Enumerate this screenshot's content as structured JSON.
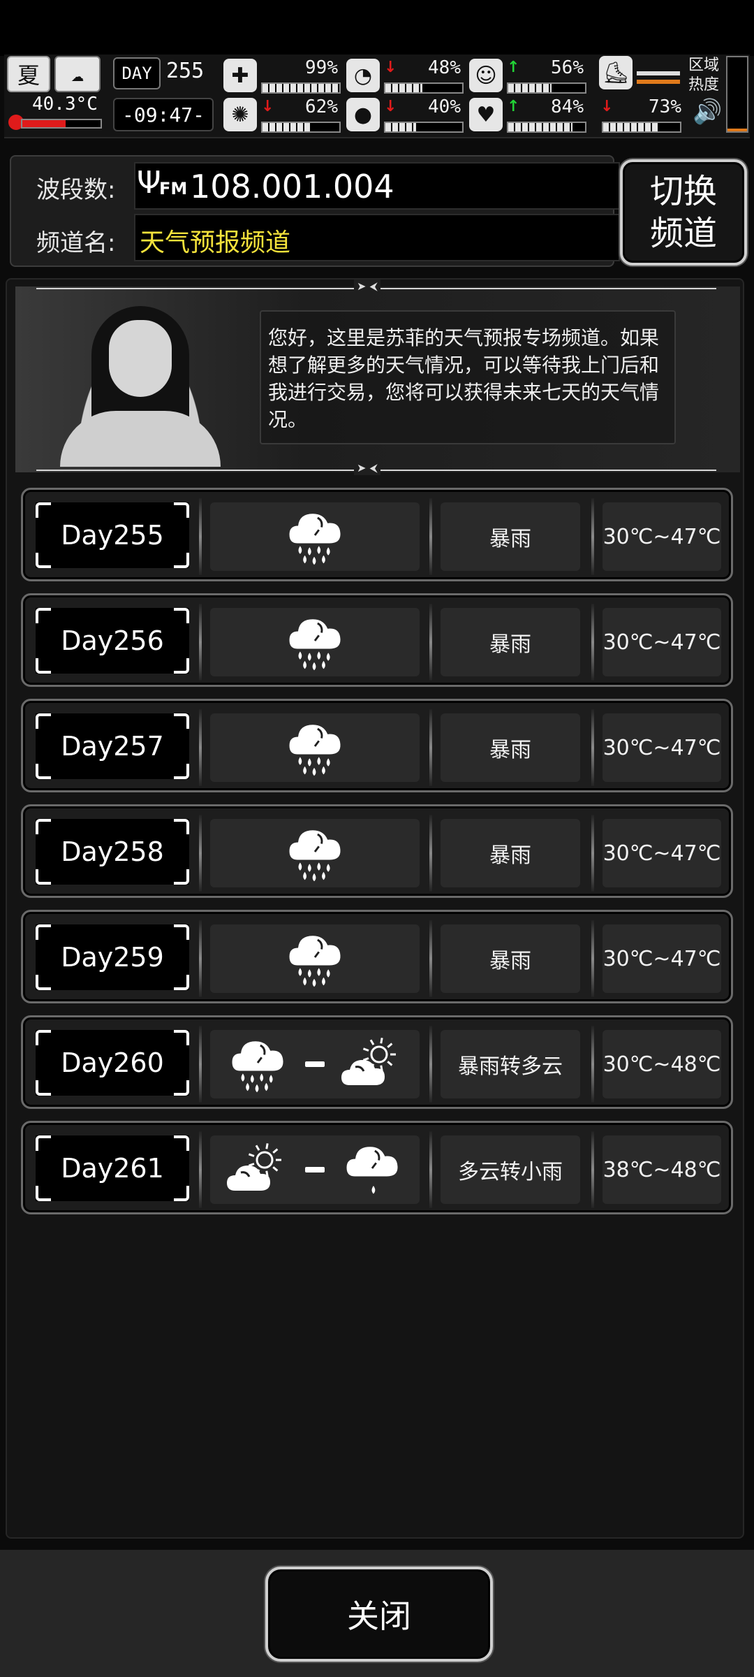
{
  "hud": {
    "season": "夏",
    "day_label": "DAY",
    "day_number": "255",
    "temperature": "40.3°C",
    "time": "-09:47-",
    "area_heat_label_1": "区域",
    "area_heat_label_2": "热度",
    "stats": [
      {
        "icon": "medkit-icon",
        "glyph": "✚",
        "value": "99%",
        "trend": "",
        "fill": 0.99
      },
      {
        "icon": "stomach-icon",
        "glyph": "◔",
        "value": "48%",
        "trend": "down",
        "fill": 0.48
      },
      {
        "icon": "mood-icon",
        "glyph": "☺",
        "value": "56%",
        "trend": "up",
        "fill": 0.56
      },
      {
        "icon": "brain-icon",
        "glyph": "✺",
        "value": "62%",
        "trend": "down",
        "fill": 0.62
      },
      {
        "icon": "water-drop-icon",
        "glyph": "💧",
        "value": "40%",
        "trend": "down",
        "fill": 0.4
      },
      {
        "icon": "heart-icon",
        "glyph": "♥",
        "value": "84%",
        "trend": "up",
        "fill": 0.84
      },
      {
        "icon": "",
        "glyph": "",
        "value": "73%",
        "trend": "down",
        "fill": 0.73
      }
    ]
  },
  "radio": {
    "freq_label": "波段数:",
    "fm_label": "FM",
    "frequency": "108.001.004",
    "channel_label": "频道名:",
    "channel_name": "天气预报频道",
    "switch_label_1": "切换",
    "switch_label_2": "频道"
  },
  "broadcast": {
    "message": "您好，这里是苏菲的天气预报专场频道。如果想了解更多的天气情况，可以等待我上门后和我进行交易，您将可以获得未来七天的天气情况。"
  },
  "forecast": [
    {
      "day": "Day255",
      "desc": "暴雨",
      "temp": "30℃~47℃",
      "icons": [
        "heavy-rain"
      ]
    },
    {
      "day": "Day256",
      "desc": "暴雨",
      "temp": "30℃~47℃",
      "icons": [
        "heavy-rain"
      ]
    },
    {
      "day": "Day257",
      "desc": "暴雨",
      "temp": "30℃~47℃",
      "icons": [
        "heavy-rain"
      ]
    },
    {
      "day": "Day258",
      "desc": "暴雨",
      "temp": "30℃~47℃",
      "icons": [
        "heavy-rain"
      ]
    },
    {
      "day": "Day259",
      "desc": "暴雨",
      "temp": "30℃~47℃",
      "icons": [
        "heavy-rain"
      ]
    },
    {
      "day": "Day260",
      "desc": "暴雨转多云",
      "temp": "30℃~48℃",
      "icons": [
        "heavy-rain",
        "partly-cloudy"
      ]
    },
    {
      "day": "Day261",
      "desc": "多云转小雨",
      "temp": "38℃~48℃",
      "icons": [
        "partly-cloudy",
        "light-rain"
      ]
    }
  ],
  "footer": {
    "close_label": "关闭"
  },
  "colors": {
    "channel_name": "#f4e23b",
    "trend_up": "#22d336",
    "trend_down": "#e01b1b",
    "temp_bar": "#e01b1b"
  }
}
